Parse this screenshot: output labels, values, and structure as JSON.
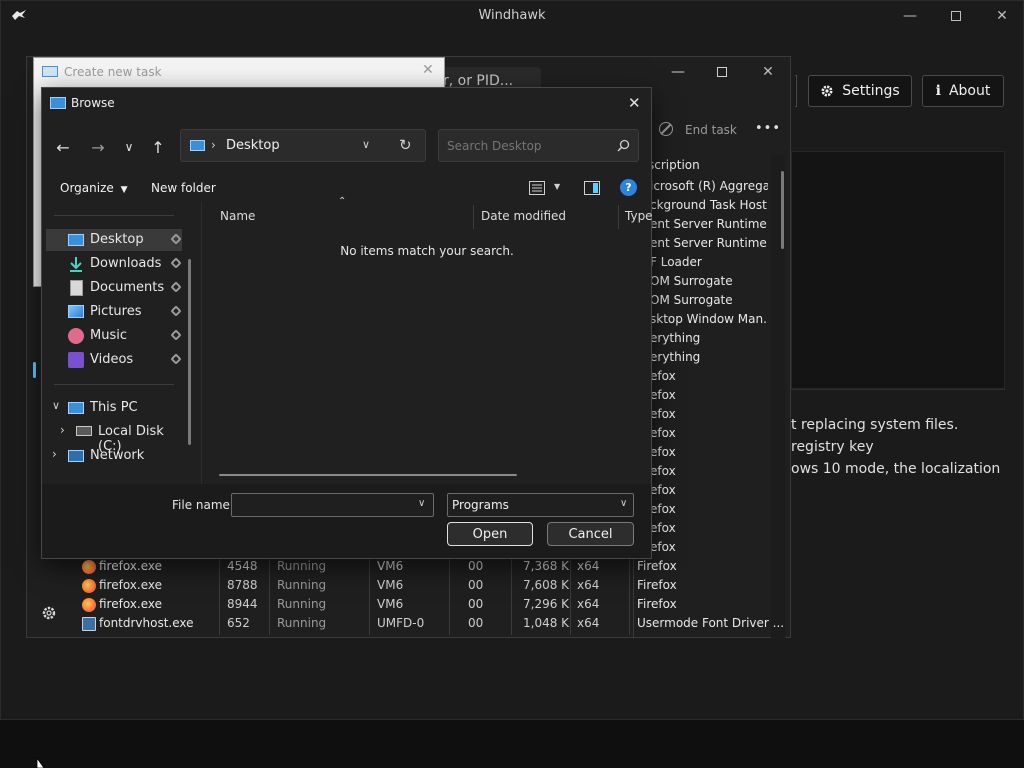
{
  "windhawk": {
    "title": "Windhawk",
    "settings_label": "Settings",
    "about_label": "About",
    "body_lines": [
      "t replacing system files.",
      "registry key",
      "ows 10 mode, the localization"
    ]
  },
  "task_manager": {
    "search_placeholder": "r, or PID...",
    "end_task_label": "End task",
    "more_label": "•••",
    "description_header": "scription",
    "process_descriptions": [
      "icrosoft (R) Aggrega...",
      "ckground Task Host",
      "ent Server Runtime ...",
      "ent Server Runtime ...",
      "F Loader",
      "OM Surrogate",
      "OM Surrogate",
      "sktop Window Man...",
      "erything",
      "erything",
      "efox",
      "efox",
      "efox",
      "efox",
      "efox",
      "efox",
      "efox",
      "efox",
      "efox",
      "efox"
    ],
    "rows": [
      {
        "name": "firefox.exe",
        "pid": "4548",
        "status": "Running",
        "user": "VM6",
        "cpu": "00",
        "mem": "7,368 K",
        "arch": "x64",
        "desc": "Firefox"
      },
      {
        "name": "firefox.exe",
        "pid": "8788",
        "status": "Running",
        "user": "VM6",
        "cpu": "00",
        "mem": "7,608 K",
        "arch": "x64",
        "desc": "Firefox"
      },
      {
        "name": "firefox.exe",
        "pid": "8944",
        "status": "Running",
        "user": "VM6",
        "cpu": "00",
        "mem": "7,296 K",
        "arch": "x64",
        "desc": "Firefox"
      },
      {
        "name": "fontdrvhost.exe",
        "pid": "652",
        "status": "Running",
        "user": "UMFD-0",
        "cpu": "00",
        "mem": "1,048 K",
        "arch": "x64",
        "desc": "Usermode Font Driver ..."
      }
    ]
  },
  "create_task": {
    "title": "Create new task"
  },
  "browse": {
    "title": "Browse",
    "breadcrumb": "Desktop",
    "search_placeholder": "Search Desktop",
    "organize_label": "Organize",
    "new_folder_label": "New folder",
    "columns": {
      "name": "Name",
      "date": "Date modified",
      "type": "Type"
    },
    "empty_message": "No items match your search.",
    "quick_access": [
      {
        "label": "Desktop",
        "icon": "desktop-icon"
      },
      {
        "label": "Downloads",
        "icon": "download-icon"
      },
      {
        "label": "Documents",
        "icon": "documents-icon"
      },
      {
        "label": "Pictures",
        "icon": "pictures-icon"
      },
      {
        "label": "Music",
        "icon": "music-icon"
      },
      {
        "label": "Videos",
        "icon": "videos-icon"
      }
    ],
    "this_pc": "This PC",
    "local_disk": "Local Disk (C:)",
    "network": "Network",
    "file_name_label": "File name:",
    "file_name_value": "",
    "filter_value": "Programs",
    "open_label": "Open",
    "cancel_label": "Cancel",
    "colors": {
      "accent": "#60cdff",
      "selected": "#3a3a3a"
    }
  }
}
